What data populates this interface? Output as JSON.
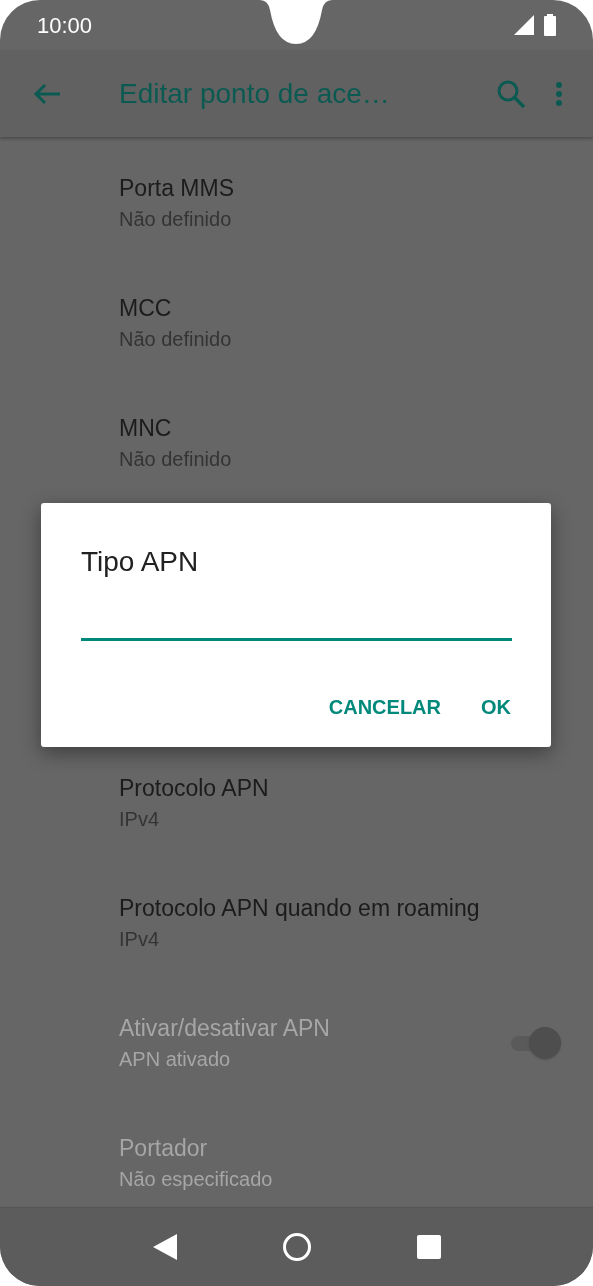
{
  "status_bar": {
    "time": "10:00"
  },
  "app_bar": {
    "title": "Editar ponto de ace…"
  },
  "items": [
    {
      "kind": "text",
      "title": "Porta MMS",
      "summary": "Não definido",
      "disabled": false
    },
    {
      "kind": "text",
      "title": "MCC",
      "summary": "Não definido",
      "disabled": false
    },
    {
      "kind": "text",
      "title": "MNC",
      "summary": "Não definido",
      "disabled": false
    },
    {
      "kind": "hidden"
    },
    {
      "kind": "hidden"
    },
    {
      "kind": "text",
      "title": "Protocolo APN",
      "summary": "IPv4",
      "disabled": false
    },
    {
      "kind": "text",
      "title": "Protocolo APN quando em roaming",
      "summary": "IPv4",
      "disabled": false
    },
    {
      "kind": "switch",
      "title": "Ativar/desativar APN",
      "summary": "APN ativado",
      "disabled": true,
      "on": true
    },
    {
      "kind": "text",
      "title": "Portador",
      "summary": "Não especificado",
      "disabled": true
    }
  ],
  "dialog": {
    "title": "Tipo APN",
    "buttons": [
      "CANCELAR",
      "OK"
    ]
  }
}
